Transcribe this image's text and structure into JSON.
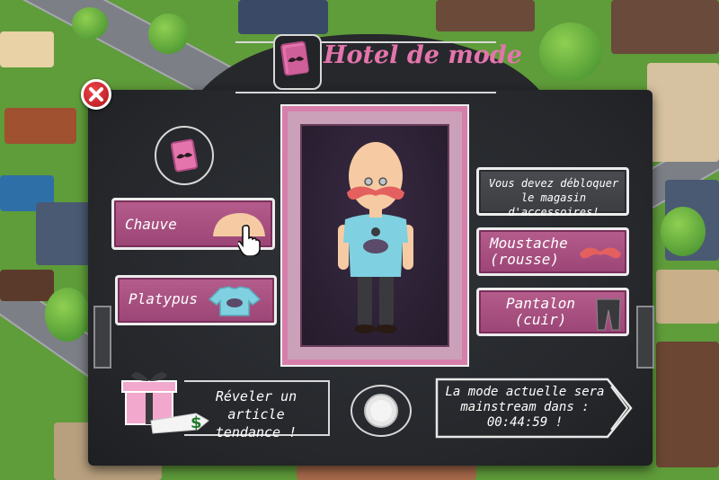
{
  "title": "Hotel de mode",
  "items": {
    "left": [
      {
        "label": "Chauve"
      },
      {
        "label": "Platypus"
      }
    ],
    "right": [
      {
        "label": "Vous devez débloquer le magasin d'accessoires!"
      },
      {
        "label_line1": "Moustache",
        "label_line2": "(rousse)"
      },
      {
        "label_line1": "Pantalon",
        "label_line2": "(cuir)"
      }
    ]
  },
  "reveal": {
    "line1": "Réveler un article",
    "line2": "tendance !",
    "price_symbol": "$"
  },
  "timer": {
    "line1": "La mode actuelle sera",
    "line2": "mainstream dans :",
    "value": "00:44:59 !"
  },
  "icons": [
    "close-icon",
    "book-mustache-icon",
    "pointer-hand-icon",
    "gift-icon",
    "coin-icon"
  ],
  "colors": {
    "accent_pink": "#e474ac",
    "button_pink": "#a84d80",
    "board": "#2a2c30"
  }
}
